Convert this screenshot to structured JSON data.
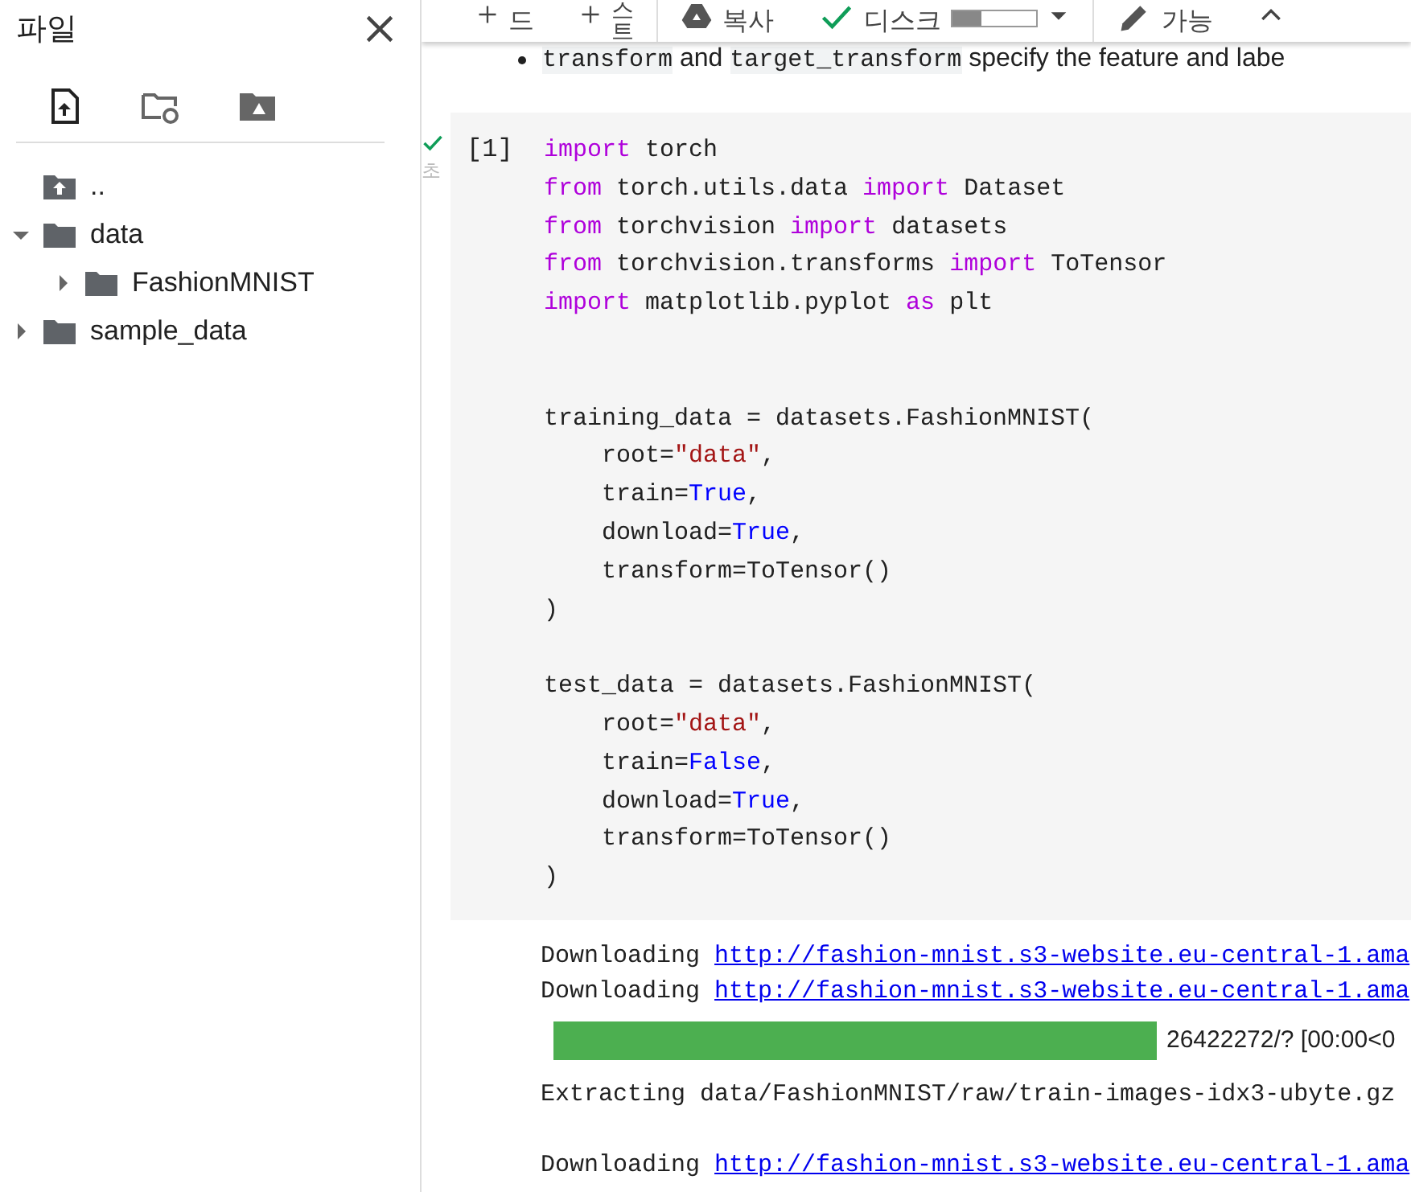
{
  "sidebar": {
    "title": "파일",
    "tree": [
      {
        "kind": "parent",
        "name": ".."
      },
      {
        "kind": "folder",
        "name": "data",
        "expanded": true,
        "children": [
          {
            "kind": "folder",
            "name": "FashionMNIST",
            "expanded": false
          }
        ]
      },
      {
        "kind": "folder",
        "name": "sample_data",
        "expanded": false
      }
    ]
  },
  "toolbar": {
    "items": [
      {
        "kind": "add",
        "label": "드"
      },
      {
        "kind": "add",
        "label": "스트"
      },
      {
        "kind": "drive",
        "label": "복사"
      },
      {
        "kind": "status",
        "label": "디스크",
        "level": 0.35
      },
      {
        "kind": "edit",
        "label": "가능"
      },
      {
        "kind": "collapse"
      }
    ]
  },
  "note": [
    {
      "kind": "code",
      "text": "transform"
    },
    {
      "kind": "text",
      "text": " and "
    },
    {
      "kind": "code",
      "text": "target_transform"
    },
    {
      "kind": "text",
      "text": " specify the feature and labe"
    }
  ],
  "cell": {
    "status": "초",
    "label": "[1]",
    "lines": [
      [
        {
          "kind": "keyword",
          "text": "import"
        },
        {
          "kind": "plain",
          "text": " torch"
        }
      ],
      [
        {
          "kind": "keyword",
          "text": "from"
        },
        {
          "kind": "plain",
          "text": " torch.utils.data "
        },
        {
          "kind": "keyword",
          "text": "import"
        },
        {
          "kind": "plain",
          "text": " Dataset"
        }
      ],
      [
        {
          "kind": "keyword",
          "text": "from"
        },
        {
          "kind": "plain",
          "text": " torchvision "
        },
        {
          "kind": "keyword",
          "text": "import"
        },
        {
          "kind": "plain",
          "text": " datasets"
        }
      ],
      [
        {
          "kind": "keyword",
          "text": "from"
        },
        {
          "kind": "plain",
          "text": " torchvision.transforms "
        },
        {
          "kind": "keyword",
          "text": "import"
        },
        {
          "kind": "plain",
          "text": " ToTensor"
        }
      ],
      [
        {
          "kind": "keyword",
          "text": "import"
        },
        {
          "kind": "plain",
          "text": " matplotlib.pyplot "
        },
        {
          "kind": "keyword",
          "text": "as"
        },
        {
          "kind": "plain",
          "text": " plt"
        }
      ],
      {
        "kind": "blank"
      },
      {
        "kind": "blank"
      },
      [
        {
          "kind": "plain",
          "text": "training_data = datasets.FashionMNIST("
        }
      ],
      [
        {
          "kind": "plain",
          "text": "    root="
        },
        {
          "kind": "string",
          "text": "\"data\""
        },
        {
          "kind": "plain",
          "text": ","
        }
      ],
      [
        {
          "kind": "plain",
          "text": "    train="
        },
        {
          "kind": "constant",
          "text": "True"
        },
        {
          "kind": "plain",
          "text": ","
        }
      ],
      [
        {
          "kind": "plain",
          "text": "    download="
        },
        {
          "kind": "constant",
          "text": "True"
        },
        {
          "kind": "plain",
          "text": ","
        }
      ],
      [
        {
          "kind": "plain",
          "text": "    transform=ToTensor()"
        }
      ],
      [
        {
          "kind": "plain",
          "text": ")"
        }
      ],
      {
        "kind": "blank"
      },
      [
        {
          "kind": "plain",
          "text": "test_data = datasets.FashionMNIST("
        }
      ],
      [
        {
          "kind": "plain",
          "text": "    root="
        },
        {
          "kind": "string",
          "text": "\"data\""
        },
        {
          "kind": "plain",
          "text": ","
        }
      ],
      [
        {
          "kind": "plain",
          "text": "    train="
        },
        {
          "kind": "constant",
          "text": "False"
        },
        {
          "kind": "plain",
          "text": ","
        }
      ],
      [
        {
          "kind": "plain",
          "text": "    download="
        },
        {
          "kind": "constant",
          "text": "True"
        },
        {
          "kind": "plain",
          "text": ","
        }
      ],
      [
        {
          "kind": "plain",
          "text": "    transform=ToTensor()"
        }
      ],
      [
        {
          "kind": "plain",
          "text": ")"
        }
      ]
    ]
  },
  "output": [
    {
      "kind": "download",
      "text": "Downloading ",
      "link": "http://fashion-mnist.s3-website.eu-central-1.ama"
    },
    {
      "kind": "download",
      "text": "Downloading ",
      "link": "http://fashion-mnist.s3-website.eu-central-1.ama"
    },
    {
      "kind": "progress",
      "level": 1,
      "text": "26422272/? [00:00<0"
    },
    {
      "kind": "text",
      "text": "Extracting data/FashionMNIST/raw/train-images-idx3-ubyte.gz"
    },
    {
      "kind": "blank"
    },
    {
      "kind": "download",
      "text": "Downloading ",
      "link": "http://fashion-mnist.s3-website.eu-central-1.ama"
    }
  ]
}
